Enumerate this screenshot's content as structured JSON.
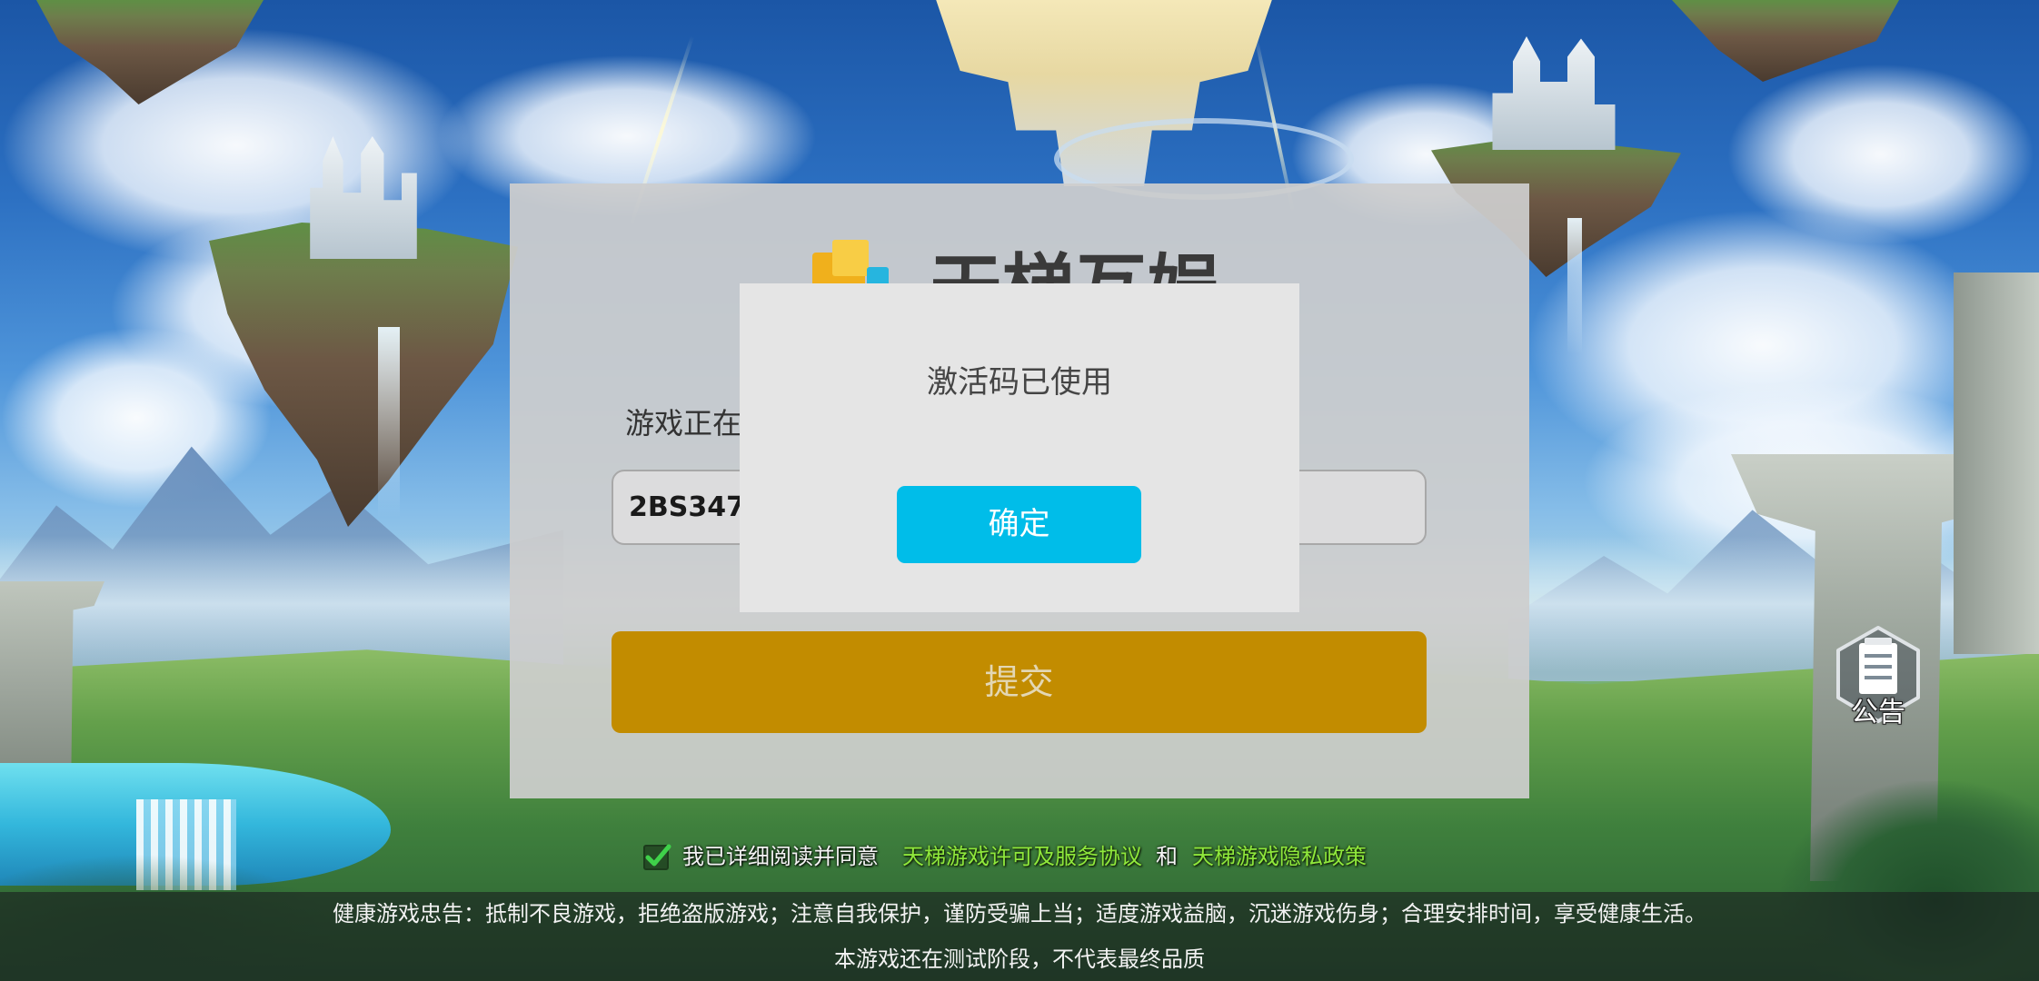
{
  "panel": {
    "logo_text": "天梯互娱",
    "logo_icon": "brand-cube-icon",
    "prompt_text": "游戏正在",
    "code_input": {
      "value": "2BS347"
    },
    "submit_label": "提交"
  },
  "dialog": {
    "message": "激活码已使用",
    "confirm_label": "确定"
  },
  "notice_button": {
    "label": "公告",
    "icon": "notice-document-icon"
  },
  "agreement": {
    "checked": true,
    "checkbox_icon": "checkmark-icon",
    "prefix": "我已详细阅读并同意",
    "license_link": "天梯游戏许可及服务协议",
    "conjunction": "和",
    "privacy_link": "天梯游戏隐私政策"
  },
  "footer": {
    "health_advice": "健康游戏忠告：抵制不良游戏，拒绝盗版游戏；注意自我保护，谨防受骗上当；适度游戏益脑，沉迷游戏伤身；合理安排时间，享受健康生活。",
    "test_notice": "本游戏还在测试阶段，不代表最终品质"
  },
  "colors": {
    "dialog_bg": "#e5e5e5",
    "submit_button": "#c28c00",
    "confirm_button": "#00bde9",
    "link_green": "#8fe83c"
  }
}
